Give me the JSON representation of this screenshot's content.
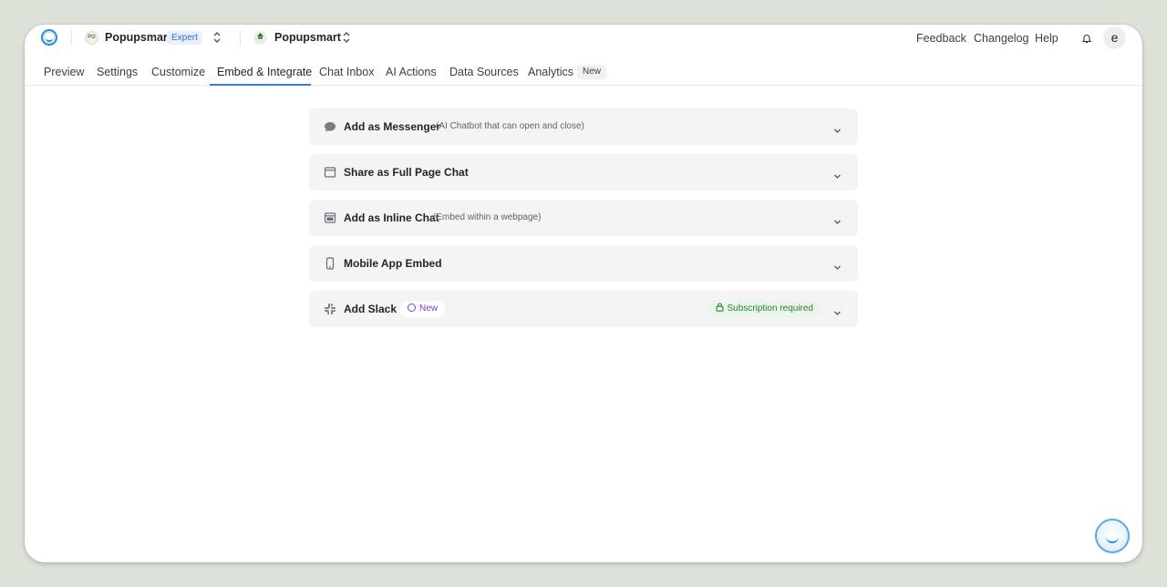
{
  "header": {
    "workspace_initials": "PO",
    "workspace_name": "Popupsmart",
    "workspace_plan": "Expert",
    "project_name": "Popupsmart",
    "links": [
      "Feedback",
      "Changelog",
      "Help"
    ],
    "user_initial": "e"
  },
  "tabs": {
    "items": [
      "Preview",
      "Settings",
      "Customize",
      "Embed & Integrate",
      "Chat Inbox",
      "AI Actions",
      "Data Sources",
      "Analytics"
    ],
    "active": "Embed & Integrate",
    "new_badge": "New"
  },
  "embed_options": [
    {
      "title": "Add as Messenger",
      "subtitle": "(AI Chatbot that can open and close)",
      "icon": "chat-bubble-icon"
    },
    {
      "title": "Share as Full Page Chat",
      "subtitle": "",
      "icon": "browser-window-icon"
    },
    {
      "title": "Add as Inline Chat",
      "subtitle": "(Embed within a webpage)",
      "icon": "inline-frame-icon"
    },
    {
      "title": "Mobile App Embed",
      "subtitle": "",
      "icon": "mobile-phone-icon"
    },
    {
      "title": "Add Slack",
      "subtitle": "",
      "icon": "slack-icon",
      "badge": "New",
      "status": "Subscription required"
    }
  ],
  "colors": {
    "accent": "#3a79d6",
    "new_purple": "#7a3fc9",
    "subscription_green": "#2e7d32"
  }
}
